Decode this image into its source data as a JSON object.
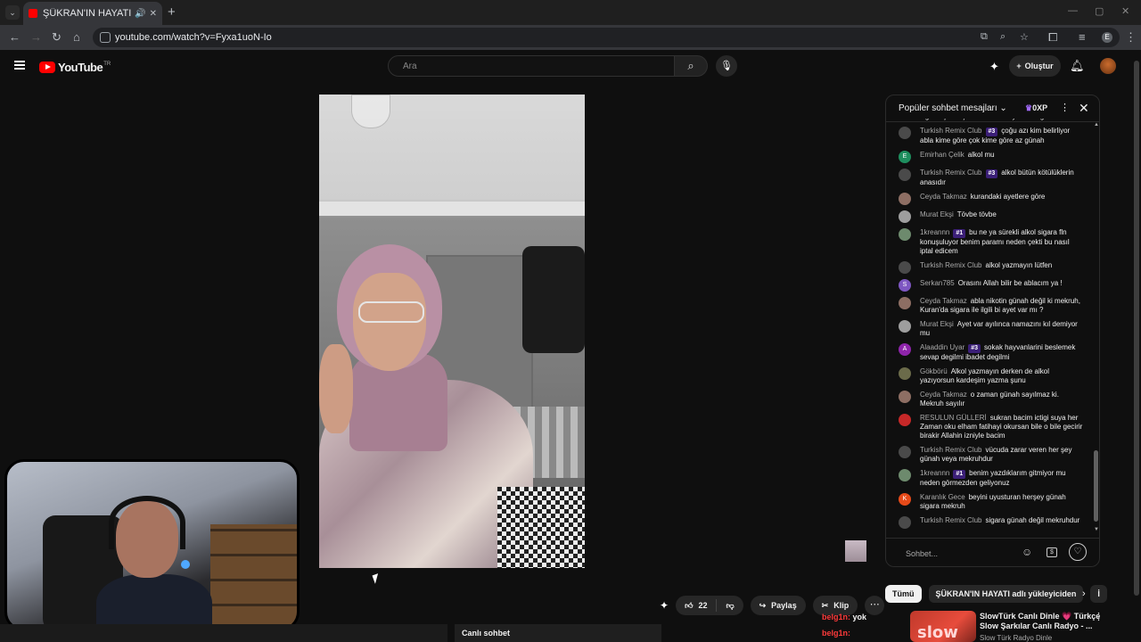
{
  "browser": {
    "tab_title": "ŞÜKRAN'IN HAYATI kanalı c",
    "tab_audio_icon": "speaker-icon",
    "url": "youtube.com/watch?v=Fyxa1uoN-Io",
    "colors": {
      "tab_bg": "#35363a",
      "frame_bg": "#1f1f1f"
    }
  },
  "youtube": {
    "logo_text": "YouTube",
    "logo_country": "TR",
    "search_placeholder": "Ara",
    "create_label": "Oluştur",
    "brand_red": "#ff0000"
  },
  "chat": {
    "header_title": "Popüler sohbet mesajları",
    "xp_label": "0XP",
    "input_placeholder": "Sohbet...",
    "messages": [
      {
        "author": "KRAL",
        "badge": "",
        "text": "Abla belli ayetler var ondu suya okuyup sigara içene içirince bırakır diyorlar doğru mudur",
        "color": "#e65100",
        "initial": "K"
      },
      {
        "author": "Turkish Remix Club",
        "badge": "#3",
        "text": "çoğu azı kim belirliyor abla kime göre çok kime göre az günah",
        "color": "#4a4a4a",
        "initial": ""
      },
      {
        "author": "Emirhan Çelik",
        "badge": "",
        "text": "alkol mu",
        "color": "#1e8e5e",
        "initial": "E"
      },
      {
        "author": "Turkish Remix Club",
        "badge": "#3",
        "text": "alkol bütün kötülüklerin anasıdır",
        "color": "#4a4a4a",
        "initial": ""
      },
      {
        "author": "Ceyda Takmaz",
        "badge": "",
        "text": "kurandaki ayetlere göre",
        "color": "#8d6e63",
        "initial": ""
      },
      {
        "author": "Murat Ekşi",
        "badge": "",
        "text": "Tövbe tövbe",
        "color": "#9e9e9e",
        "initial": ""
      },
      {
        "author": "1kreannn",
        "badge": "#1",
        "text": "bu ne ya sürekli alkol sigara fln konuşuluyor benim paramı neden çekti bu nasıl iptal edicem",
        "color": "#6d8a6d",
        "initial": ""
      },
      {
        "author": "Turkish Remix Club",
        "badge": "",
        "text": "alkol yazmayın lütfen",
        "color": "#4a4a4a",
        "initial": ""
      },
      {
        "author": "Serkan785",
        "badge": "",
        "text": "Orasını Allah bilir be ablacım ya !",
        "color": "#7e57c2",
        "initial": "S"
      },
      {
        "author": "Ceyda Takmaz",
        "badge": "",
        "text": "abla nikotin günah değil ki mekruh, Kuran'da sigara ile ilgili bi ayet var mı ?",
        "color": "#8d6e63",
        "initial": ""
      },
      {
        "author": "Murat Ekşi",
        "badge": "",
        "text": "Ayet var ayılınca namazını kıl demiyor mu",
        "color": "#9e9e9e",
        "initial": ""
      },
      {
        "author": "Alaaddin Uyar",
        "badge": "#3",
        "text": "sokak hayvanlarini beslemek sevap degilmi ibadet degilmi",
        "color": "#8e24aa",
        "initial": "A"
      },
      {
        "author": "Gökbörü",
        "badge": "",
        "text": "Alkol yazmayın derken de alkol yazıyorsun kardeşim yazma şunu",
        "color": "#6b6b4a",
        "initial": ""
      },
      {
        "author": "Ceyda Takmaz",
        "badge": "",
        "text": "o zaman günah sayılmaz ki. Mekruh sayılır",
        "color": "#8d6e63",
        "initial": ""
      },
      {
        "author": "RESULUN GÜLLERİ",
        "badge": "",
        "text": "sukran bacim ictigi suya her Zaman oku elham fatihayi okursan bile o bile gecirir birakir Allahin izniyle bacim",
        "color": "#c62828",
        "initial": ""
      },
      {
        "author": "Turkish Remix Club",
        "badge": "",
        "text": "vücuda zarar veren her şey günah veya mekruhdur",
        "color": "#4a4a4a",
        "initial": ""
      },
      {
        "author": "1kreannn",
        "badge": "#1",
        "text": "benim yazdıklarım gitmiyor mu neden görmezden geliyonuz",
        "color": "#6d8a6d",
        "initial": ""
      },
      {
        "author": "Karanlık Gece",
        "badge": "",
        "text": "beyini uyusturan herşey günah sigara mekruh",
        "color": "#e64a19",
        "initial": "K"
      },
      {
        "author": "Turkish Remix Club",
        "badge": "",
        "text": "sigara günah değil mekruhdur",
        "color": "#4a4a4a",
        "initial": ""
      }
    ]
  },
  "actions": {
    "like_count": "22",
    "share_label": "Paylaş",
    "clip_label": "Klip",
    "overlay_name_1": "belg1n:",
    "overlay_text_1": "yok",
    "overlay_name_2": "belg1n:"
  },
  "below": {
    "live_chat_label": "Canlı sohbet"
  },
  "chips": [
    "Tümü",
    "ŞÜKRAN'IN HAYATI adlı yükleyiciden",
    "İ"
  ],
  "recommendation": {
    "title": "SlowTürk Canlı Dinle 💗 Türkçe Slow Şarkılar Canlı Radyo - ...",
    "channel": "Slow Türk Radyo Dinle",
    "thumb_text": "slow"
  }
}
